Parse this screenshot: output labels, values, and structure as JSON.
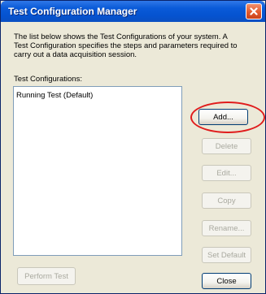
{
  "window": {
    "title": "Test Configuration Manager",
    "close_icon": "close-icon",
    "accent_color": "#0a5ad8",
    "close_color": "#e35a2c"
  },
  "description": {
    "line1": "The list below shows the Test Configurations of your system. A",
    "line2": "Test Configuration specifies the steps and parameters required to",
    "line3": "carry out a data acquisition session."
  },
  "configurations": {
    "label": "Test Configurations:",
    "items": [
      {
        "label": "Running Test  (Default)"
      }
    ]
  },
  "buttons": {
    "add": "Add...",
    "delete": "Delete",
    "edit": "Edit...",
    "copy": "Copy",
    "rename": "Rename...",
    "set_default": "Set Default",
    "close": "Close",
    "perform_test": "Perform Test"
  },
  "annotation": {
    "highlight_color": "#e01c1c"
  }
}
